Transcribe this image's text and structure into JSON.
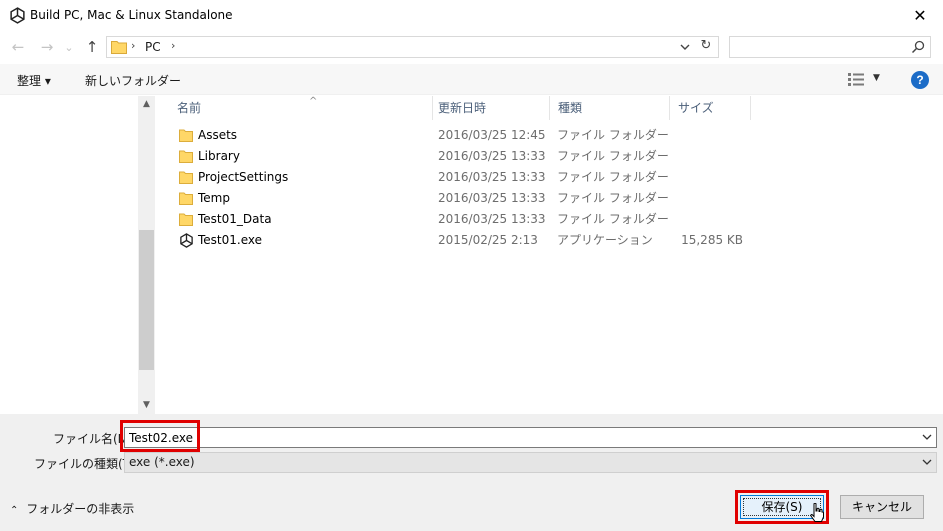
{
  "window": {
    "title": "Build PC, Mac & Linux Standalone",
    "close_label": "✕"
  },
  "nav": {
    "back_icon": "←",
    "forward_icon": "→",
    "recent_icon": "⌄",
    "up_icon": "↑",
    "path": "PC",
    "refresh_icon": "↻",
    "search_placeholder": ""
  },
  "toolbar": {
    "organize_label": "整理 ▾",
    "new_folder_label": "新しいフォルダー",
    "help_label": "?"
  },
  "columns": {
    "name": "名前",
    "date": "更新日時",
    "type": "種類",
    "size": "サイズ"
  },
  "files": [
    {
      "name": "Assets",
      "date": "2016/03/25 12:45",
      "type": "ファイル フォルダー",
      "size": "",
      "icon": "folder-icon"
    },
    {
      "name": "Library",
      "date": "2016/03/25 13:33",
      "type": "ファイル フォルダー",
      "size": "",
      "icon": "folder-icon"
    },
    {
      "name": "ProjectSettings",
      "date": "2016/03/25 13:33",
      "type": "ファイル フォルダー",
      "size": "",
      "icon": "folder-icon"
    },
    {
      "name": "Temp",
      "date": "2016/03/25 13:33",
      "type": "ファイル フォルダー",
      "size": "",
      "icon": "folder-icon"
    },
    {
      "name": "Test01_Data",
      "date": "2016/03/25 13:33",
      "type": "ファイル フォルダー",
      "size": "",
      "icon": "folder-icon"
    },
    {
      "name": "Test01.exe",
      "date": "2015/02/25 2:13",
      "type": "アプリケーション",
      "size": "15,285 KB",
      "icon": "unity-app-icon"
    }
  ],
  "form": {
    "filename_label": "ファイル名(N):",
    "filename_value": "Test02.exe",
    "filetype_label": "ファイルの種類(T):",
    "filetype_value": "exe (*.exe)"
  },
  "footer": {
    "hide_folders_label": "フォルダーの非表示",
    "save_label": "保存(S)",
    "cancel_label": "キャンセル"
  },
  "colors": {
    "highlight": "#e00000",
    "folder": "#ffd767",
    "accent": "#0078d7"
  }
}
